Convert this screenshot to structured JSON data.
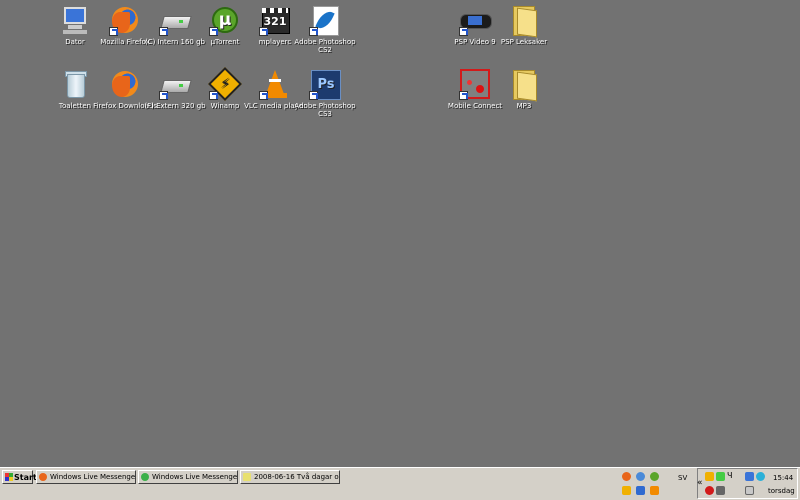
{
  "desktop": {
    "icons": [
      {
        "name": "dator",
        "label": "Dator"
      },
      {
        "name": "mozilla-firefox",
        "label": "Mozilla Firefox"
      },
      {
        "name": "intern-drive",
        "label": "(C) Intern  160 gb"
      },
      {
        "name": "utorrent",
        "label": "µTorrent"
      },
      {
        "name": "mplayerc",
        "label": "mplayerc"
      },
      {
        "name": "photoshop-cs2",
        "label": "Adobe Photoshop CS2"
      },
      {
        "name": "psp-video-9",
        "label": "PSP Video 9"
      },
      {
        "name": "psp-leksaker",
        "label": "PSP Leksaker"
      },
      {
        "name": "toaletten",
        "label": "Toaletten"
      },
      {
        "name": "firefox-downloads",
        "label": "Firefox Downloads"
      },
      {
        "name": "extern-drive",
        "label": "(F) Extern 320 gb"
      },
      {
        "name": "winamp",
        "label": "Winamp"
      },
      {
        "name": "vlc-media-player",
        "label": "VLC media player"
      },
      {
        "name": "photoshop-cs3",
        "label": "Adobe Photoshop CS3"
      },
      {
        "name": "mobile-connect",
        "label": "Mobile Connect"
      },
      {
        "name": "mp3",
        "label": "MP3"
      }
    ]
  },
  "taskbar": {
    "start_label": "Start",
    "tasks": [
      {
        "label": "Windows Live Messenger...",
        "icon": "firefox-icon"
      },
      {
        "label": "Windows Live Messenger",
        "icon": "messenger-icon"
      },
      {
        "label": "2008-06-16 Två dagar o...",
        "icon": "notepad-icon"
      }
    ],
    "language": "SV",
    "chevron": "«",
    "ps_badge": "Ч",
    "time": "15:44",
    "day": "torsdag"
  },
  "colors": {
    "desktop": "#727272",
    "taskbar": "#d4d0c8",
    "icon_text": "#ffffff"
  }
}
